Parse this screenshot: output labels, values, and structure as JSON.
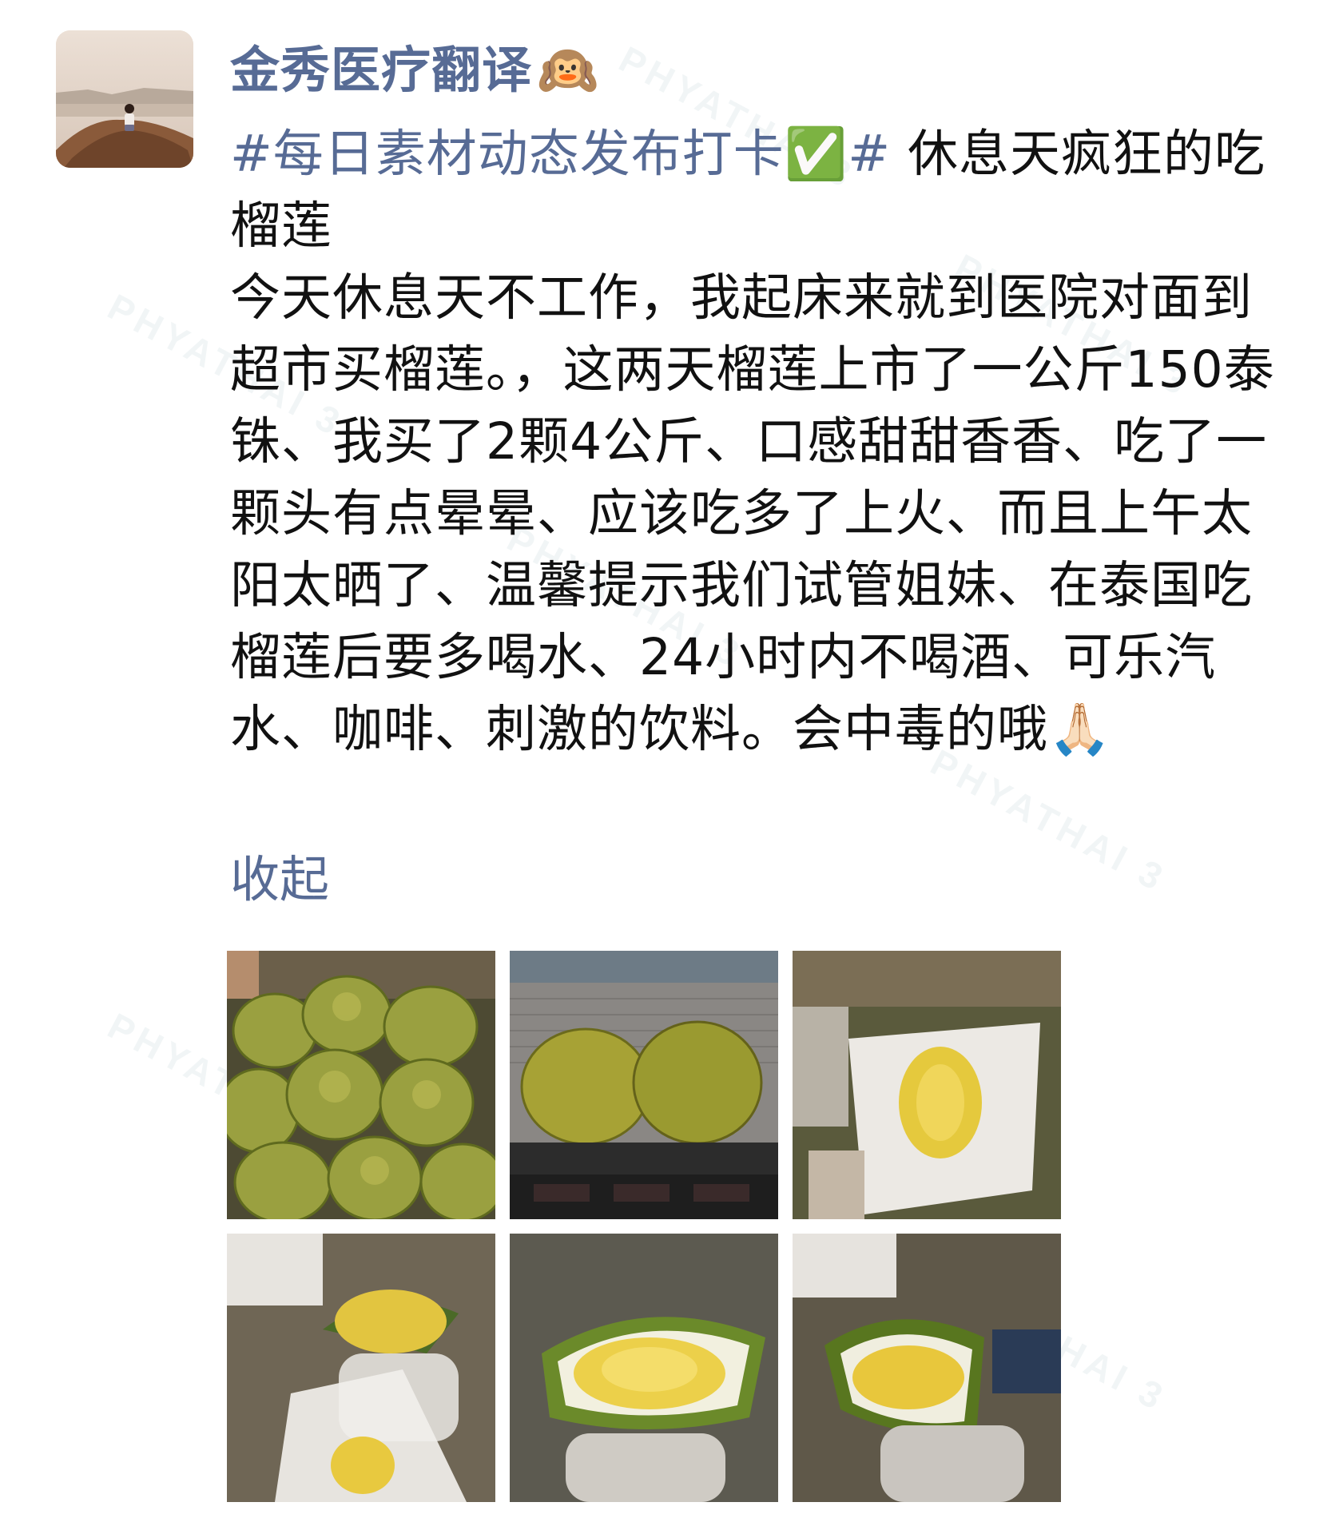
{
  "post": {
    "author_name": "金秀医疗翻译",
    "author_emoji": "🙉",
    "topic_tag": "#每日素材动态发布打卡✅#",
    "title_text": " 休息天疯狂的吃榴莲",
    "body_text": "今天休息天不工作，我起床来就到医院对面到超市买榴莲。，这两天榴莲上市了一公斤150泰铢、我买了2颗4公斤、口感甜甜香香、吃了一颗头有点晕晕、应该吃多了上火、而且上午太阳太晒了、温馨提示我们试管姐妹、在泰国吃榴莲后要多喝水、24小时内不喝酒、可乐汽水、咖啡、刺激的饮料。会中毒的哦🙏🏻",
    "collapse_label": "收起"
  },
  "watermark": {
    "text": "PHYATHAI 3",
    "color": "#e7eef0"
  },
  "colors": {
    "link": "#576b95",
    "body_text": "#111111",
    "background": "#ffffff"
  }
}
